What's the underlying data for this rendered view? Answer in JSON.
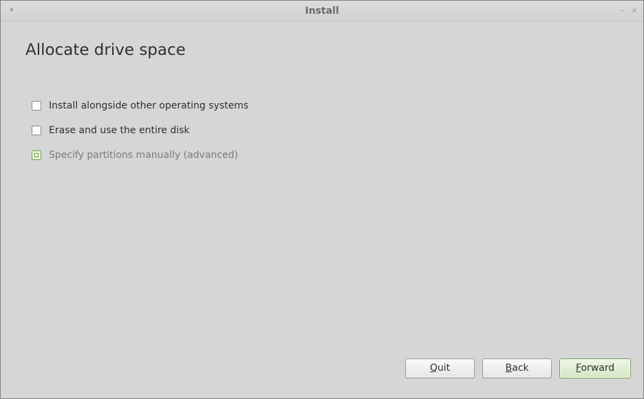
{
  "window": {
    "title": "Install",
    "menu_icon": "▾",
    "minimize_icon": "–",
    "close_icon": "×"
  },
  "page": {
    "title": "Allocate drive space"
  },
  "options": [
    {
      "label": "Install alongside other operating systems",
      "checked": false
    },
    {
      "label": "Erase and use the entire disk",
      "checked": false
    },
    {
      "label": "Specify partitions manually (advanced)",
      "checked": true
    }
  ],
  "buttons": {
    "quit": {
      "accel": "Q",
      "rest": "uit"
    },
    "back": {
      "accel": "B",
      "rest": "ack"
    },
    "forward": {
      "accel": "F",
      "rest": "orward"
    }
  },
  "colors": {
    "accent": "#6aa14a",
    "background": "#d6d6d6"
  }
}
